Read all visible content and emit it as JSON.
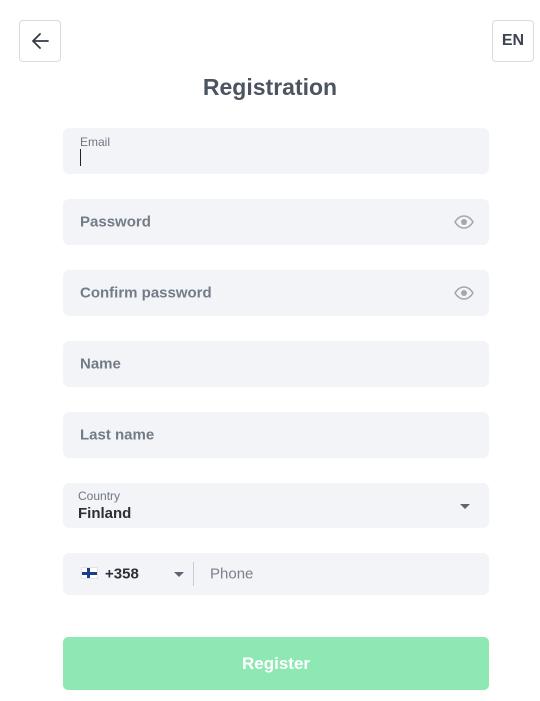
{
  "header": {
    "back_icon": "arrow-left-icon",
    "language": "EN"
  },
  "title": "Registration",
  "form": {
    "email": {
      "label": "Email",
      "value": ""
    },
    "password": {
      "placeholder": "Password",
      "icon": "eye-icon"
    },
    "confirm_password": {
      "placeholder": "Confirm password",
      "icon": "eye-icon"
    },
    "name": {
      "placeholder": "Name"
    },
    "last_name": {
      "placeholder": "Last name"
    },
    "country": {
      "label": "Country",
      "value": "Finland",
      "icon": "chevron-down-icon"
    },
    "phone": {
      "flag": "finland-flag-icon",
      "dial_code": "+358",
      "placeholder": "Phone"
    }
  },
  "actions": {
    "register_label": "Register"
  },
  "colors": {
    "field_background": "#f3f4f8",
    "register_button": "#8ee8b4",
    "title_text": "#4b5562"
  }
}
